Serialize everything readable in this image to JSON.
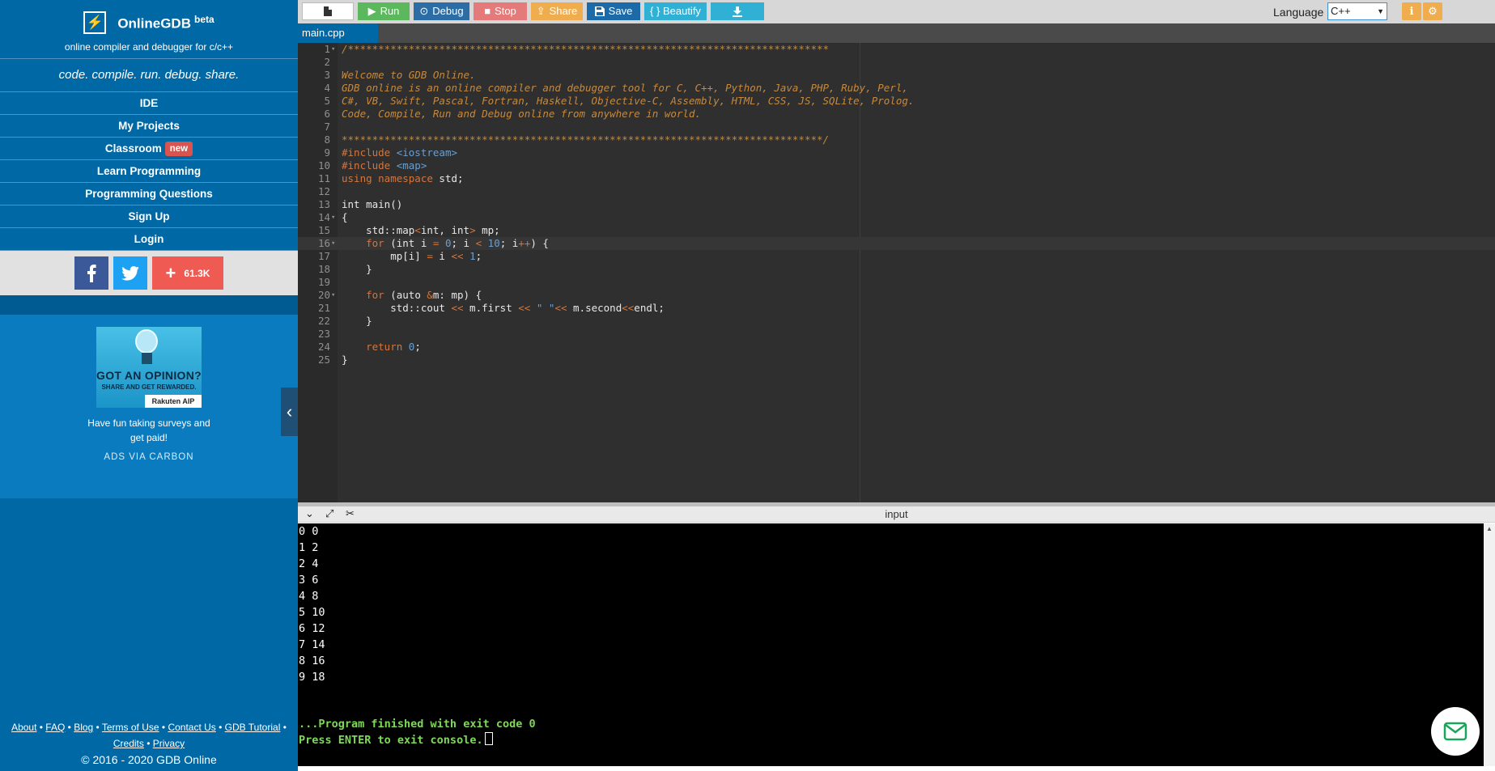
{
  "brand": {
    "name": "OnlineGDB",
    "sup": "beta",
    "subtitle": "online compiler and debugger for c/c++",
    "tagline": "code. compile. run. debug. share."
  },
  "nav": [
    {
      "label": "IDE"
    },
    {
      "label": "My Projects"
    },
    {
      "label": "Classroom",
      "badge": "new"
    },
    {
      "label": "Learn Programming"
    },
    {
      "label": "Programming Questions"
    },
    {
      "label": "Sign Up"
    },
    {
      "label": "Login"
    }
  ],
  "social": {
    "share_count": "61.3K"
  },
  "ad": {
    "headline": "GOT AN OPINION?",
    "subline": "SHARE AND GET REWARDED.",
    "brand": "Rakuten AIP",
    "text": "Have fun taking surveys and get paid!",
    "via": "ADS VIA CARBON"
  },
  "footer": {
    "links": [
      "About",
      "FAQ",
      "Blog",
      "Terms of Use",
      "Contact Us",
      "GDB Tutorial",
      "Credits",
      "Privacy"
    ],
    "copyright": "© 2016 - 2020 GDB Online"
  },
  "toolbar": {
    "run": "Run",
    "debug": "Debug",
    "stop": "Stop",
    "share": "Share",
    "save": "Save",
    "beautify": "{ } Beautify",
    "language_label": "Language",
    "language_value": "C++"
  },
  "file_tab": "main.cpp",
  "active_line": 16,
  "code": [
    [
      [
        "/*******************************************************************************",
        "com"
      ]
    ],
    [],
    [
      [
        "Welcome to GDB Online.",
        "com"
      ]
    ],
    [
      [
        "GDB online is an online compiler and debugger tool for C, C++, Python, Java, PHP, Ruby, Perl,",
        "com"
      ]
    ],
    [
      [
        "C#, VB, Swift, Pascal, Fortran, Haskell, Objective-C, Assembly, HTML, CSS, JS, SQLite, Prolog.",
        "com"
      ]
    ],
    [
      [
        "Code, Compile, Run and Debug online from anywhere in world.",
        "com"
      ]
    ],
    [],
    [
      [
        "*******************************************************************************/",
        "com"
      ]
    ],
    [
      [
        "#include ",
        "kw"
      ],
      [
        "<iostream>",
        "str"
      ]
    ],
    [
      [
        "#include ",
        "kw"
      ],
      [
        "<map>",
        "str"
      ]
    ],
    [
      [
        "using namespace ",
        "kw"
      ],
      [
        "std;",
        "id"
      ]
    ],
    [],
    [
      [
        "int main()",
        "id"
      ]
    ],
    [
      [
        "{",
        "id"
      ]
    ],
    [
      [
        "    std::map",
        "id"
      ],
      [
        "<",
        "kw"
      ],
      [
        "int, int",
        "id"
      ],
      [
        ">",
        "kw"
      ],
      [
        " mp;",
        "id"
      ]
    ],
    [
      [
        "    ",
        "id"
      ],
      [
        "for",
        "kw"
      ],
      [
        " (int i ",
        "id"
      ],
      [
        "=",
        "kw"
      ],
      [
        " ",
        "id"
      ],
      [
        "0",
        "num"
      ],
      [
        "; i ",
        "id"
      ],
      [
        "<",
        "kw"
      ],
      [
        " ",
        "id"
      ],
      [
        "10",
        "num"
      ],
      [
        "; i",
        "id"
      ],
      [
        "++",
        "kw"
      ],
      [
        ") {",
        "id"
      ]
    ],
    [
      [
        "        mp[i] ",
        "id"
      ],
      [
        "=",
        "kw"
      ],
      [
        " i ",
        "id"
      ],
      [
        "<<",
        "kw"
      ],
      [
        " ",
        "id"
      ],
      [
        "1",
        "num"
      ],
      [
        ";",
        "id"
      ]
    ],
    [
      [
        "    }",
        "id"
      ]
    ],
    [],
    [
      [
        "    ",
        "id"
      ],
      [
        "for",
        "kw"
      ],
      [
        " (auto ",
        "id"
      ],
      [
        "&",
        "kw"
      ],
      [
        "m: mp) {",
        "id"
      ]
    ],
    [
      [
        "        std::cout ",
        "id"
      ],
      [
        "<<",
        "kw"
      ],
      [
        " m.first ",
        "id"
      ],
      [
        "<<",
        "kw"
      ],
      [
        " ",
        "id"
      ],
      [
        "\" \"",
        "str"
      ],
      [
        "<<",
        "kw"
      ],
      [
        " m.second",
        "id"
      ],
      [
        "<<",
        "kw"
      ],
      [
        "endl;",
        "id"
      ]
    ],
    [
      [
        "    }",
        "id"
      ]
    ],
    [],
    [
      [
        "    ",
        "id"
      ],
      [
        "return",
        "kw"
      ],
      [
        " ",
        "id"
      ],
      [
        "0",
        "num"
      ],
      [
        ";",
        "id"
      ]
    ],
    [
      [
        "}",
        "id"
      ]
    ]
  ],
  "fold_lines": [
    1,
    14,
    16,
    20
  ],
  "output_header": {
    "title": "input"
  },
  "output": [
    "0 0",
    "1 2",
    "2 4",
    "3 6",
    "4 8",
    "5 10",
    "6 12",
    "7 14",
    "8 16",
    "9 18"
  ],
  "finish_msg": "...Program finished with exit code 0",
  "press_msg": "Press ENTER to exit console."
}
